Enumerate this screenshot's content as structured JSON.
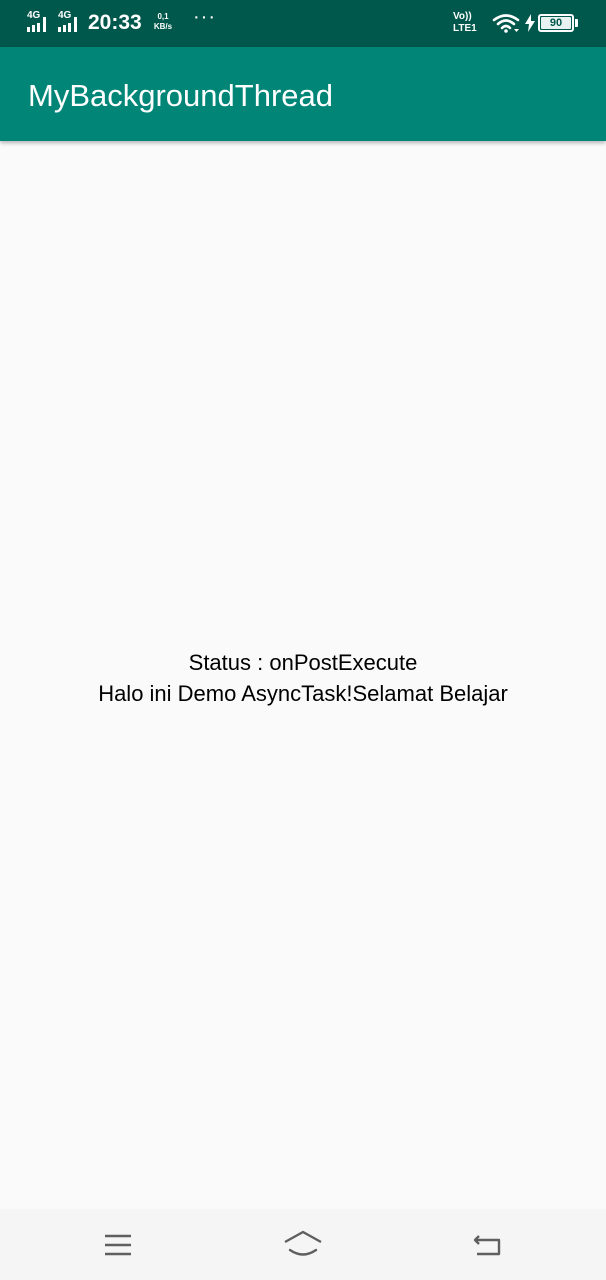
{
  "status_bar": {
    "sim1_network": "4G",
    "sim2_network": "4G",
    "time": "20:33",
    "speed_value": "0,1",
    "speed_unit": "KB/s",
    "overflow_dots": "···",
    "volte_label": "Vo))",
    "lte_label": "LTE1",
    "battery_level": "90"
  },
  "app_bar": {
    "title": "MyBackgroundThread"
  },
  "main": {
    "status_text": "Status : onPostExecute",
    "message_text": "Halo ini Demo AsyncTask!Selamat Belajar"
  },
  "nav_bar": {
    "icons": [
      "menu-icon",
      "home-icon",
      "back-icon"
    ]
  },
  "colors": {
    "status_bar": "#00574b",
    "app_bar": "#008577",
    "background": "#fafafa",
    "nav_bar": "#f5f5f5"
  }
}
